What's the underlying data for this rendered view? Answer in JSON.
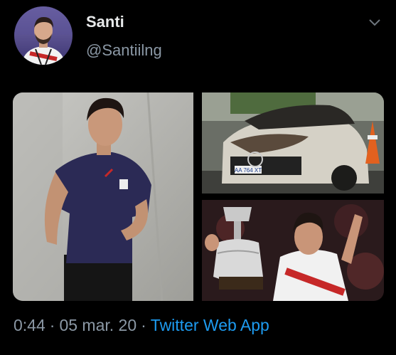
{
  "tweet": {
    "author_name": "Santi",
    "author_handle": "@Santiilng",
    "time": "0:44",
    "separator": "·",
    "date": "05 mar. 20",
    "source": "Twitter Web App"
  },
  "colors": {
    "background": "#000000",
    "name": "#e7e9ea",
    "secondary": "#8b98a5",
    "link": "#1d9bf0"
  },
  "icons": {
    "more": "chevron-down-icon"
  },
  "media": [
    {
      "type": "photo",
      "plate_text": "AA 764 XT"
    },
    {
      "type": "photo"
    },
    {
      "type": "photo"
    }
  ]
}
